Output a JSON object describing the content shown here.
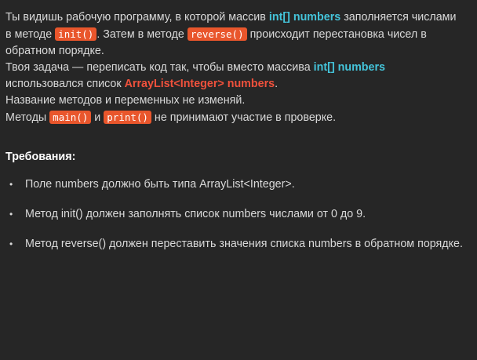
{
  "description": {
    "line1_a": "Ты видишь рабочую программу, в которой массив ",
    "line1_var": "int[] numbers",
    "line1_b": " заполняется числами в методе ",
    "method_init": "init()",
    "line1_c": ". Затем в методе ",
    "method_reverse": "reverse()",
    "line1_d": " происходит перестановка чисел в обратном порядке.",
    "line2_a": "Твоя задача — переписать код так, чтобы вместо массива ",
    "line2_var": "int[] numbers",
    "line2_b": " использовался список ",
    "line2_list": "ArrayList<Integer> numbers",
    "line2_c": ".",
    "line3": "Название методов и переменных не изменяй.",
    "line4_a": "Методы ",
    "method_main": "main()",
    "line4_b": " и ",
    "method_print": "print()",
    "line4_c": " не принимают участие в проверке."
  },
  "requirements": {
    "title": "Требования:",
    "items": [
      {
        "bullet": "•",
        "text": "Поле numbers должно быть типа ArrayList<Integer>."
      },
      {
        "bullet": "•",
        "text": "Метод init() должен заполнять список numbers числами от 0 до 9."
      },
      {
        "bullet": "•",
        "text": "Метод reverse() должен переставить значения списка numbers в обратном порядке."
      }
    ]
  },
  "colors": {
    "background": "#262626",
    "text": "#d9d9d9",
    "highlight_cyan": "#44c4da",
    "highlight_red": "#f0513c",
    "code_badge": "#e9562c"
  }
}
